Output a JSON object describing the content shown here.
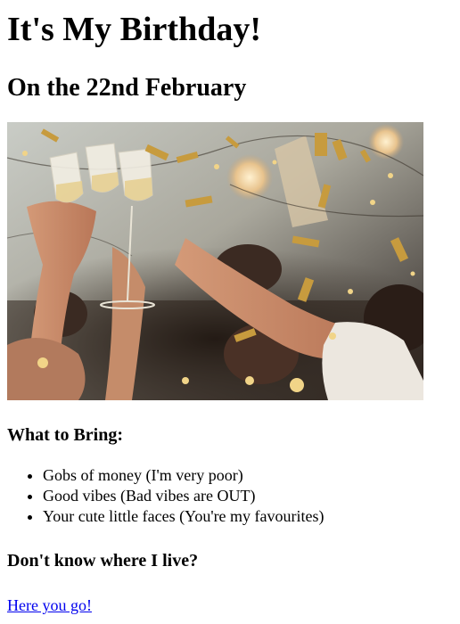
{
  "page": {
    "title": "It's My Birthday!",
    "subtitle": "On the 22nd February"
  },
  "hero_image": {
    "alt": "people toasting with champagne glasses amid falling gold confetti"
  },
  "bring": {
    "heading": "What to Bring:",
    "items": [
      "Gobs of money (I'm very poor)",
      "Good vibes (Bad vibes are OUT)",
      "Your cute little faces (You're my favourites)"
    ]
  },
  "location": {
    "heading": "Don't know where I live?",
    "link_text": "Here you go!"
  },
  "colors": {
    "link": "#0000ee",
    "text": "#000000",
    "background": "#ffffff"
  }
}
